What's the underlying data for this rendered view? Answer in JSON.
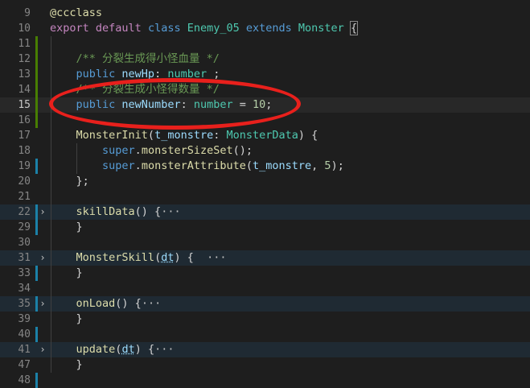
{
  "lines": [
    {
      "num": "9",
      "tokens": [
        {
          "t": "@ccclass",
          "c": "deco"
        }
      ]
    },
    {
      "num": "10",
      "tokens": [
        {
          "t": "export ",
          "c": "kw2"
        },
        {
          "t": "default ",
          "c": "kw2"
        },
        {
          "t": "class ",
          "c": "kw"
        },
        {
          "t": "Enemy_05 ",
          "c": "cls"
        },
        {
          "t": "extends ",
          "c": "kw"
        },
        {
          "t": "Monster ",
          "c": "cls"
        },
        {
          "t": "{",
          "c": "punc",
          "box": true
        }
      ]
    },
    {
      "num": "11",
      "git": "added",
      "tokens": []
    },
    {
      "num": "12",
      "git": "added",
      "tokens": [
        {
          "t": "    /** 分裂生成得小怪血量 */",
          "c": "cmt"
        }
      ]
    },
    {
      "num": "13",
      "git": "added",
      "tokens": [
        {
          "t": "    ",
          "c": "punc"
        },
        {
          "t": "public ",
          "c": "kw"
        },
        {
          "t": "newHp",
          "c": "var"
        },
        {
          "t": ": ",
          "c": "punc"
        },
        {
          "t": "number",
          "c": "cls"
        },
        {
          "t": " ;",
          "c": "punc"
        }
      ]
    },
    {
      "num": "14",
      "git": "added",
      "tokens": [
        {
          "t": "    /** 分裂生成小怪得数量 */",
          "c": "cmt"
        }
      ]
    },
    {
      "num": "15",
      "git": "added",
      "current": true,
      "tokens": [
        {
          "t": "    ",
          "c": "punc"
        },
        {
          "t": "public ",
          "c": "kw"
        },
        {
          "t": "newNumber",
          "c": "var"
        },
        {
          "t": ": ",
          "c": "punc"
        },
        {
          "t": "number",
          "c": "cls"
        },
        {
          "t": " = ",
          "c": "punc"
        },
        {
          "t": "10",
          "c": "num"
        },
        {
          "t": ";",
          "c": "punc"
        }
      ]
    },
    {
      "num": "16",
      "git": "added",
      "tokens": []
    },
    {
      "num": "17",
      "tokens": [
        {
          "t": "    ",
          "c": "punc"
        },
        {
          "t": "MonsterInit",
          "c": "fn"
        },
        {
          "t": "(",
          "c": "punc"
        },
        {
          "t": "t_monstre",
          "c": "var"
        },
        {
          "t": ": ",
          "c": "punc"
        },
        {
          "t": "MonsterData",
          "c": "cls"
        },
        {
          "t": ") {",
          "c": "punc"
        }
      ]
    },
    {
      "num": "18",
      "tokens": [
        {
          "t": "        ",
          "c": "punc"
        },
        {
          "t": "super",
          "c": "kw"
        },
        {
          "t": ".",
          "c": "punc"
        },
        {
          "t": "monsterSizeSet",
          "c": "fn"
        },
        {
          "t": "();",
          "c": "punc"
        }
      ]
    },
    {
      "num": "19",
      "git": "modified",
      "tokens": [
        {
          "t": "        ",
          "c": "punc"
        },
        {
          "t": "super",
          "c": "kw"
        },
        {
          "t": ".",
          "c": "punc"
        },
        {
          "t": "monsterAttribute",
          "c": "fn"
        },
        {
          "t": "(",
          "c": "punc"
        },
        {
          "t": "t_monstre",
          "c": "var"
        },
        {
          "t": ", ",
          "c": "punc"
        },
        {
          "t": "5",
          "c": "num"
        },
        {
          "t": ");",
          "c": "punc"
        }
      ]
    },
    {
      "num": "20",
      "tokens": [
        {
          "t": "    };",
          "c": "punc"
        }
      ]
    },
    {
      "num": "21",
      "tokens": []
    },
    {
      "num": "22",
      "git": "modified",
      "fold": true,
      "folded": true,
      "tokens": [
        {
          "t": "    ",
          "c": "punc"
        },
        {
          "t": "skillData",
          "c": "fn"
        },
        {
          "t": "() {",
          "c": "punc"
        },
        {
          "t": "···",
          "c": "ell"
        }
      ]
    },
    {
      "num": "29",
      "git": "modified",
      "tokens": [
        {
          "t": "    }",
          "c": "punc"
        }
      ]
    },
    {
      "num": "30",
      "tokens": []
    },
    {
      "num": "31",
      "fold": true,
      "folded": true,
      "tokens": [
        {
          "t": "    ",
          "c": "punc"
        },
        {
          "t": "MonsterSkill",
          "c": "fn"
        },
        {
          "t": "(",
          "c": "punc"
        },
        {
          "t": "dt",
          "c": "var",
          "sq": true
        },
        {
          "t": ") { ",
          "c": "punc"
        },
        {
          "t": " ···",
          "c": "ell"
        }
      ]
    },
    {
      "num": "33",
      "git": "modified",
      "tokens": [
        {
          "t": "    }",
          "c": "punc"
        }
      ]
    },
    {
      "num": "34",
      "tokens": []
    },
    {
      "num": "35",
      "git": "modified",
      "fold": true,
      "folded": true,
      "tokens": [
        {
          "t": "    ",
          "c": "punc"
        },
        {
          "t": "onLoad",
          "c": "fn"
        },
        {
          "t": "() {",
          "c": "punc"
        },
        {
          "t": "···",
          "c": "ell"
        }
      ]
    },
    {
      "num": "39",
      "tokens": [
        {
          "t": "    }",
          "c": "punc"
        }
      ]
    },
    {
      "num": "40",
      "git": "modified",
      "tokens": []
    },
    {
      "num": "41",
      "fold": true,
      "folded": true,
      "tokens": [
        {
          "t": "    ",
          "c": "punc"
        },
        {
          "t": "update",
          "c": "fn"
        },
        {
          "t": "(",
          "c": "punc"
        },
        {
          "t": "dt",
          "c": "var",
          "sq": true
        },
        {
          "t": ") {",
          "c": "punc"
        },
        {
          "t": "···",
          "c": "ell"
        }
      ]
    },
    {
      "num": "47",
      "tokens": [
        {
          "t": "    }",
          "c": "punc"
        }
      ]
    },
    {
      "num": "48",
      "git": "modified",
      "tokens": []
    }
  ],
  "fold_icon_glyph": "›",
  "annotation_color": "#e8201c"
}
